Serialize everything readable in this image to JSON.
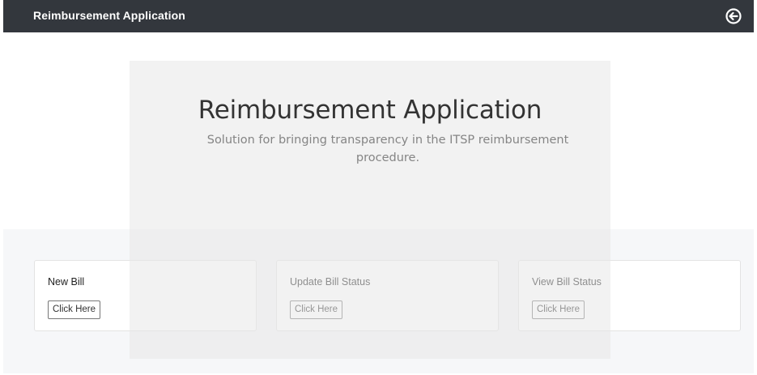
{
  "header": {
    "brand": "Reimbursement Application",
    "logout_icon": "circle-arrow-left-icon"
  },
  "hero": {
    "title": "Reimbursement Application",
    "subtitle": "Solution for bringing transparency in the ITSP reimbursement procedure."
  },
  "cards": [
    {
      "title": "New Bill",
      "button": "Click Here"
    },
    {
      "title": "Update Bill Status",
      "button": "Click Here"
    },
    {
      "title": "View Bill Status",
      "button": "Click Here"
    }
  ],
  "colors": {
    "navbar": "#33373d",
    "band": "#f6f7f9",
    "jumbotron": "#e8e8e8"
  }
}
